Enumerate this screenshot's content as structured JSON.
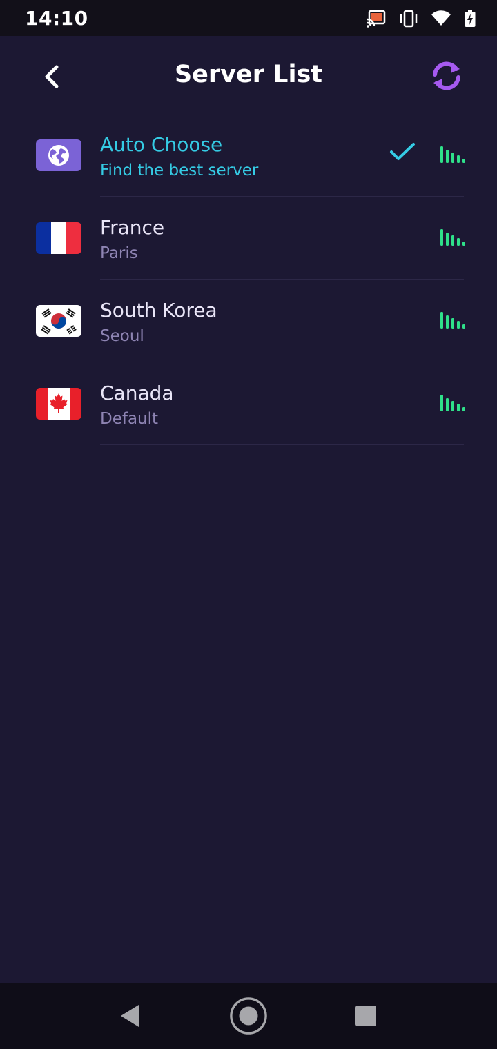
{
  "status_bar": {
    "time": "14:10",
    "icons": [
      "cast-icon",
      "vibrate-icon",
      "wifi-icon",
      "battery-charging-icon"
    ]
  },
  "header": {
    "title": "Server List",
    "back_icon": "chevron-left-icon",
    "refresh_icon": "refresh-icon"
  },
  "colors": {
    "background": "#1c1833",
    "accent": "#35cbe4",
    "signal": "#2fe08a",
    "refresh": "#a65af0"
  },
  "servers": [
    {
      "name": "Auto Choose",
      "subtitle": "Find the best server",
      "flag": "globe-icon",
      "selected": true
    },
    {
      "name": "France",
      "subtitle": "Paris",
      "flag": "france-flag",
      "selected": false
    },
    {
      "name": "South Korea",
      "subtitle": "Seoul",
      "flag": "south-korea-flag",
      "selected": false
    },
    {
      "name": "Canada",
      "subtitle": "Default",
      "flag": "canada-flag",
      "selected": false
    }
  ],
  "nav_bar": {
    "icons": [
      "back-triangle-icon",
      "home-circle-icon",
      "recents-square-icon"
    ]
  }
}
